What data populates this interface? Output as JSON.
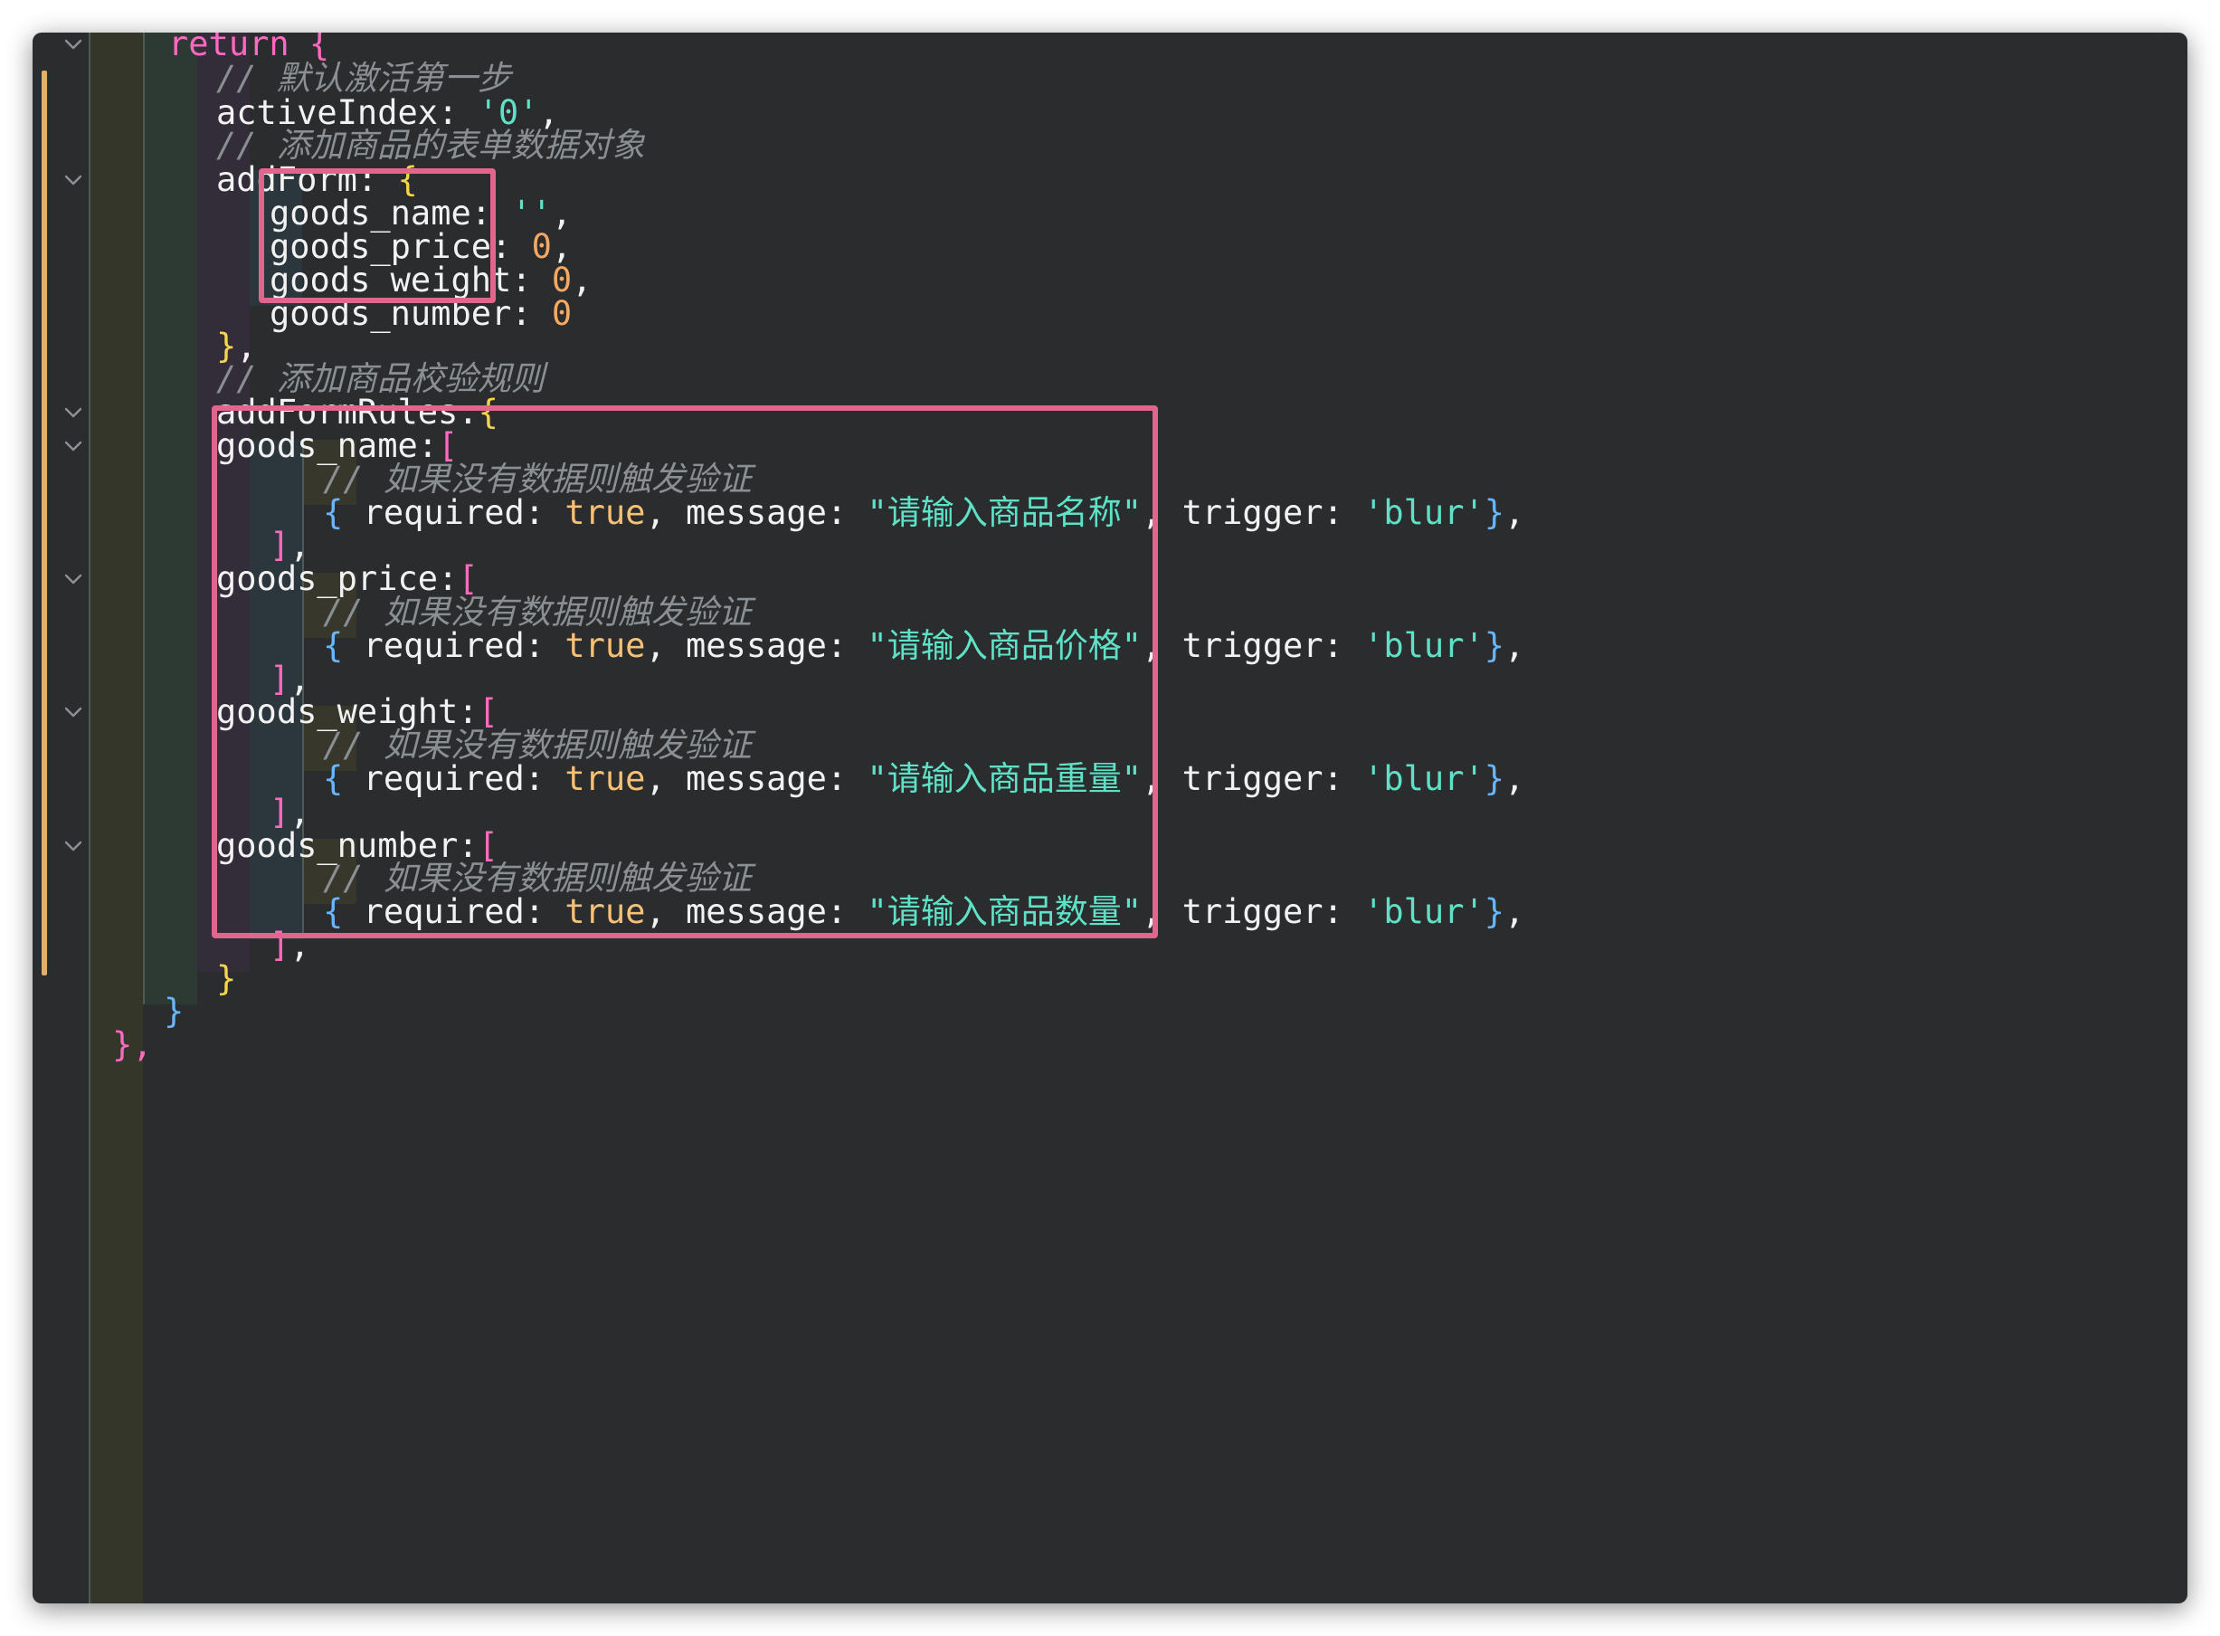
{
  "editor": {
    "theme_colors": {
      "background": "#2a2c2d",
      "keyword": "#ff6ac1",
      "comment": "#8a8f93",
      "string": "#5ee1c6",
      "number": "#f6a862",
      "boolean": "#f6c177",
      "brace_yellow": "#f5d64b",
      "brace_pink": "#ff6ac1",
      "brace_blue": "#68b6ff",
      "highlight_box": "#e0668d",
      "git_modified": "#e2b06b"
    },
    "lines": [
      {
        "id": "return",
        "fold": true,
        "tokens": [
          {
            "t": "return {",
            "c": "keyword"
          }
        ]
      },
      {
        "id": "c1",
        "fold": false,
        "tokens": [
          {
            "t": "// 默认激活第一步",
            "c": "comment"
          }
        ]
      },
      {
        "id": "activeIndex",
        "fold": false,
        "tokens": [
          {
            "t": "activeIndex: ",
            "c": "plain"
          },
          {
            "t": "'0'",
            "c": "string"
          },
          {
            "t": ",",
            "c": "plain"
          }
        ]
      },
      {
        "id": "c2",
        "fold": false,
        "tokens": [
          {
            "t": "// 添加商品的表单数据对象",
            "c": "comment"
          }
        ]
      },
      {
        "id": "addForm",
        "fold": true,
        "tokens": [
          {
            "t": "addForm: ",
            "c": "plain"
          },
          {
            "t": "{",
            "c": "brace_yellow"
          }
        ]
      },
      {
        "id": "f_name",
        "fold": false,
        "tokens": [
          {
            "t": "goods_name: ",
            "c": "plain"
          },
          {
            "t": "''",
            "c": "string"
          },
          {
            "t": ",",
            "c": "plain"
          }
        ]
      },
      {
        "id": "f_price",
        "fold": false,
        "tokens": [
          {
            "t": "goods_price: ",
            "c": "plain"
          },
          {
            "t": "0",
            "c": "number"
          },
          {
            "t": ",",
            "c": "plain"
          }
        ]
      },
      {
        "id": "f_weight",
        "fold": false,
        "tokens": [
          {
            "t": "goods_weight: ",
            "c": "plain"
          },
          {
            "t": "0",
            "c": "number"
          },
          {
            "t": ",",
            "c": "plain"
          }
        ]
      },
      {
        "id": "f_number",
        "fold": false,
        "tokens": [
          {
            "t": "goods_number: ",
            "c": "plain"
          },
          {
            "t": "0",
            "c": "number"
          }
        ]
      },
      {
        "id": "addForm_close",
        "fold": false,
        "tokens": [
          {
            "t": "}",
            "c": "brace_yellow"
          },
          {
            "t": ",",
            "c": "plain"
          }
        ]
      },
      {
        "id": "c3",
        "fold": false,
        "tokens": [
          {
            "t": "// 添加商品校验规则",
            "c": "comment"
          }
        ]
      },
      {
        "id": "addFormRules",
        "fold": true,
        "tokens": [
          {
            "t": "addFormRules:",
            "c": "plain"
          },
          {
            "t": "{",
            "c": "brace_yellow"
          }
        ]
      },
      {
        "id": "r_name",
        "fold": true,
        "tokens": [
          {
            "t": "goods_name:",
            "c": "plain"
          },
          {
            "t": "[",
            "c": "brace_pink"
          }
        ]
      },
      {
        "id": "r_name_c",
        "fold": false,
        "tokens": [
          {
            "t": "// 如果没有数据则触发验证",
            "c": "comment"
          }
        ]
      },
      {
        "id": "r_name_rule",
        "fold": false,
        "tokens": [
          {
            "t": "{",
            "c": "brace_blue"
          },
          {
            "t": " required: ",
            "c": "plain"
          },
          {
            "t": "true",
            "c": "boolean"
          },
          {
            "t": ", message: ",
            "c": "plain"
          },
          {
            "t": "\"请输入商品名称\"",
            "c": "string"
          },
          {
            "t": ", trigger: ",
            "c": "plain"
          },
          {
            "t": "'blur'",
            "c": "string"
          },
          {
            "t": "}",
            "c": "brace_blue"
          },
          {
            "t": ",",
            "c": "plain"
          }
        ]
      },
      {
        "id": "r_name_close",
        "fold": false,
        "tokens": [
          {
            "t": "]",
            "c": "brace_pink"
          },
          {
            "t": ",",
            "c": "plain"
          }
        ]
      },
      {
        "id": "r_price",
        "fold": true,
        "tokens": [
          {
            "t": "goods_price:",
            "c": "plain"
          },
          {
            "t": "[",
            "c": "brace_pink"
          }
        ]
      },
      {
        "id": "r_price_c",
        "fold": false,
        "tokens": [
          {
            "t": "// 如果没有数据则触发验证",
            "c": "comment"
          }
        ]
      },
      {
        "id": "r_price_rule",
        "fold": false,
        "tokens": [
          {
            "t": "{",
            "c": "brace_blue"
          },
          {
            "t": " required: ",
            "c": "plain"
          },
          {
            "t": "true",
            "c": "boolean"
          },
          {
            "t": ", message: ",
            "c": "plain"
          },
          {
            "t": "\"请输入商品价格\"",
            "c": "string"
          },
          {
            "t": ", trigger: ",
            "c": "plain"
          },
          {
            "t": "'blur'",
            "c": "string"
          },
          {
            "t": "}",
            "c": "brace_blue"
          },
          {
            "t": ",",
            "c": "plain"
          }
        ]
      },
      {
        "id": "r_price_close",
        "fold": false,
        "tokens": [
          {
            "t": "]",
            "c": "brace_pink"
          },
          {
            "t": ",",
            "c": "plain"
          }
        ]
      },
      {
        "id": "r_weight",
        "fold": true,
        "tokens": [
          {
            "t": "goods_weight:",
            "c": "plain"
          },
          {
            "t": "[",
            "c": "brace_pink"
          }
        ]
      },
      {
        "id": "r_weight_c",
        "fold": false,
        "tokens": [
          {
            "t": "// 如果没有数据则触发验证",
            "c": "comment"
          }
        ]
      },
      {
        "id": "r_weight_rule",
        "fold": false,
        "tokens": [
          {
            "t": "{",
            "c": "brace_blue"
          },
          {
            "t": " required: ",
            "c": "plain"
          },
          {
            "t": "true",
            "c": "boolean"
          },
          {
            "t": ", message: ",
            "c": "plain"
          },
          {
            "t": "\"请输入商品重量\"",
            "c": "string"
          },
          {
            "t": ", trigger: ",
            "c": "plain"
          },
          {
            "t": "'blur'",
            "c": "string"
          },
          {
            "t": "}",
            "c": "brace_blue"
          },
          {
            "t": ",",
            "c": "plain"
          }
        ]
      },
      {
        "id": "r_weight_close",
        "fold": false,
        "tokens": [
          {
            "t": "]",
            "c": "brace_pink"
          },
          {
            "t": ",",
            "c": "plain"
          }
        ]
      },
      {
        "id": "r_number",
        "fold": true,
        "tokens": [
          {
            "t": "goods_number:",
            "c": "plain"
          },
          {
            "t": "[",
            "c": "brace_pink"
          }
        ]
      },
      {
        "id": "r_number_c",
        "fold": false,
        "tokens": [
          {
            "t": "// 如果没有数据则触发验证",
            "c": "comment"
          }
        ]
      },
      {
        "id": "r_number_rule",
        "fold": false,
        "tokens": [
          {
            "t": "{",
            "c": "brace_blue"
          },
          {
            "t": " required: ",
            "c": "plain"
          },
          {
            "t": "true",
            "c": "boolean"
          },
          {
            "t": ", message: ",
            "c": "plain"
          },
          {
            "t": "\"请输入商品数量\"",
            "c": "string"
          },
          {
            "t": ", trigger: ",
            "c": "plain"
          },
          {
            "t": "'blur'",
            "c": "string"
          },
          {
            "t": "}",
            "c": "brace_blue"
          },
          {
            "t": ",",
            "c": "plain"
          }
        ]
      },
      {
        "id": "r_number_close",
        "fold": false,
        "tokens": [
          {
            "t": "]",
            "c": "brace_pink"
          },
          {
            "t": ",",
            "c": "plain"
          }
        ]
      },
      {
        "id": "addFormRules_close",
        "fold": false,
        "tokens": [
          {
            "t": "}",
            "c": "brace_yellow"
          }
        ]
      },
      {
        "id": "return_close",
        "fold": false,
        "tokens": [
          {
            "t": "}",
            "c": "brace_blue"
          }
        ]
      },
      {
        "id": "data_close",
        "fold": false,
        "tokens": [
          {
            "t": "},",
            "c": "brace_pink"
          }
        ]
      }
    ]
  }
}
